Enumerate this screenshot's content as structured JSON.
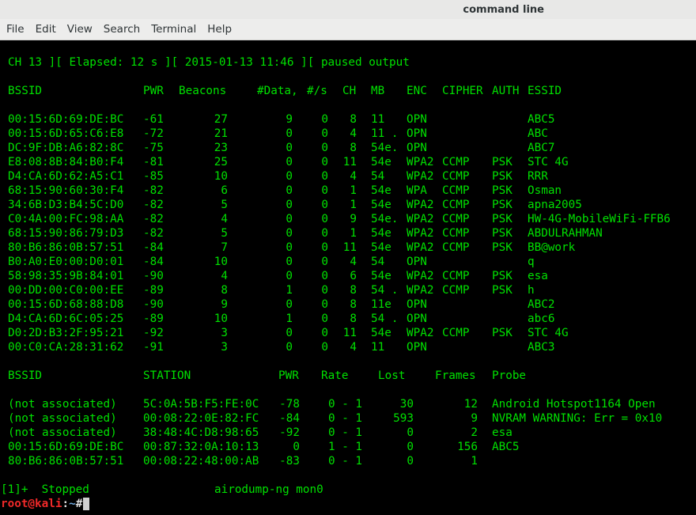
{
  "window": {
    "title": "command line"
  },
  "menu": [
    "File",
    "Edit",
    "View",
    "Search",
    "Terminal",
    "Help"
  ],
  "status_line": "CH 13 ][ Elapsed: 12 s ][ 2015-01-13 11:46 ][ paused output",
  "ap_headers": {
    "bssid": "BSSID",
    "pwr": "PWR",
    "beacons": "Beacons",
    "data": "#Data,",
    "rate": "#/s",
    "ch": "CH",
    "mb": "MB",
    "enc": "ENC",
    "cipher": "CIPHER",
    "auth": "AUTH",
    "essid": "ESSID"
  },
  "ap_rows": [
    {
      "bssid": "00:15:6D:69:DE:BC",
      "pwr": "-61",
      "beacons": "27",
      "data": "9",
      "rate": "0",
      "ch": "8",
      "mb": "11",
      "enc": "OPN",
      "cipher": "",
      "auth": "",
      "essid": "ABC5"
    },
    {
      "bssid": "00:15:6D:65:C6:E8",
      "pwr": "-72",
      "beacons": "21",
      "data": "0",
      "rate": "0",
      "ch": "4",
      "mb": "11 .",
      "enc": "OPN",
      "cipher": "",
      "auth": "",
      "essid": "ABC"
    },
    {
      "bssid": "DC:9F:DB:A6:82:8C",
      "pwr": "-75",
      "beacons": "23",
      "data": "0",
      "rate": "0",
      "ch": "8",
      "mb": "54e.",
      "enc": "OPN",
      "cipher": "",
      "auth": "",
      "essid": "ABC7"
    },
    {
      "bssid": "E8:08:8B:84:B0:F4",
      "pwr": "-81",
      "beacons": "25",
      "data": "0",
      "rate": "0",
      "ch": "11",
      "mb": "54e",
      "enc": "WPA2",
      "cipher": "CCMP",
      "auth": "PSK",
      "essid": "STC 4G"
    },
    {
      "bssid": "D4:CA:6D:62:A5:C1",
      "pwr": "-85",
      "beacons": "10",
      "data": "0",
      "rate": "0",
      "ch": "4",
      "mb": "54",
      "enc": "WPA2",
      "cipher": "CCMP",
      "auth": "PSK",
      "essid": "RRR"
    },
    {
      "bssid": "68:15:90:60:30:F4",
      "pwr": "-82",
      "beacons": "6",
      "data": "0",
      "rate": "0",
      "ch": "1",
      "mb": "54e",
      "enc": "WPA",
      "cipher": "CCMP",
      "auth": "PSK",
      "essid": "Osman"
    },
    {
      "bssid": "34:6B:D3:B4:5C:D0",
      "pwr": "-82",
      "beacons": "5",
      "data": "0",
      "rate": "0",
      "ch": "1",
      "mb": "54e",
      "enc": "WPA2",
      "cipher": "CCMP",
      "auth": "PSK",
      "essid": "apna2005"
    },
    {
      "bssid": "C0:4A:00:FC:98:AA",
      "pwr": "-82",
      "beacons": "4",
      "data": "0",
      "rate": "0",
      "ch": "9",
      "mb": "54e.",
      "enc": "WPA2",
      "cipher": "CCMP",
      "auth": "PSK",
      "essid": "HW-4G-MobileWiFi-FFB6"
    },
    {
      "bssid": "68:15:90:86:79:D3",
      "pwr": "-82",
      "beacons": "5",
      "data": "0",
      "rate": "0",
      "ch": "1",
      "mb": "54e",
      "enc": "WPA2",
      "cipher": "CCMP",
      "auth": "PSK",
      "essid": "ABDULRAHMAN"
    },
    {
      "bssid": "80:B6:86:0B:57:51",
      "pwr": "-84",
      "beacons": "7",
      "data": "0",
      "rate": "0",
      "ch": "11",
      "mb": "54e",
      "enc": "WPA2",
      "cipher": "CCMP",
      "auth": "PSK",
      "essid": "BB@work"
    },
    {
      "bssid": "B0:A0:E0:00:D0:01",
      "pwr": "-84",
      "beacons": "10",
      "data": "0",
      "rate": "0",
      "ch": "4",
      "mb": "54",
      "enc": "OPN",
      "cipher": "",
      "auth": "",
      "essid": "q"
    },
    {
      "bssid": "58:98:35:9B:84:01",
      "pwr": "-90",
      "beacons": "4",
      "data": "0",
      "rate": "0",
      "ch": "6",
      "mb": "54e",
      "enc": "WPA2",
      "cipher": "CCMP",
      "auth": "PSK",
      "essid": "esa"
    },
    {
      "bssid": "00:DD:00:C0:00:EE",
      "pwr": "-89",
      "beacons": "8",
      "data": "1",
      "rate": "0",
      "ch": "8",
      "mb": "54 .",
      "enc": "WPA2",
      "cipher": "CCMP",
      "auth": "PSK",
      "essid": "h"
    },
    {
      "bssid": "00:15:6D:68:88:D8",
      "pwr": "-90",
      "beacons": "9",
      "data": "0",
      "rate": "0",
      "ch": "8",
      "mb": "11e",
      "enc": "OPN",
      "cipher": "",
      "auth": "",
      "essid": "ABC2"
    },
    {
      "bssid": "D4:CA:6D:6C:05:25",
      "pwr": "-89",
      "beacons": "10",
      "data": "1",
      "rate": "0",
      "ch": "8",
      "mb": "54 .",
      "enc": "OPN",
      "cipher": "",
      "auth": "",
      "essid": "abc6"
    },
    {
      "bssid": "D0:2D:B3:2F:95:21",
      "pwr": "-92",
      "beacons": "3",
      "data": "0",
      "rate": "0",
      "ch": "11",
      "mb": "54e",
      "enc": "WPA2",
      "cipher": "CCMP",
      "auth": "PSK",
      "essid": "STC 4G"
    },
    {
      "bssid": "00:C0:CA:28:31:62",
      "pwr": "-91",
      "beacons": "3",
      "data": "0",
      "rate": "0",
      "ch": "4",
      "mb": "11",
      "enc": "OPN",
      "cipher": "",
      "auth": "",
      "essid": "ABC3"
    }
  ],
  "sta_headers": {
    "bssid": "BSSID",
    "station": "STATION",
    "pwr": "PWR",
    "rate": "Rate",
    "lost": "Lost",
    "frames": "Frames",
    "probe": "Probe"
  },
  "sta_rows": [
    {
      "bssid": "(not associated)",
      "station": "5C:0A:5B:F5:FE:0C",
      "pwr": "-78",
      "rate": "0 - 1",
      "lost": "30",
      "frames": "12",
      "probe": "Android Hotspot1164 Open"
    },
    {
      "bssid": "(not associated)",
      "station": "00:08:22:0E:82:FC",
      "pwr": "-84",
      "rate": "0 - 1",
      "lost": "593",
      "frames": "9",
      "probe": "NVRAM WARNING: Err = 0x10"
    },
    {
      "bssid": "(not associated)",
      "station": "38:48:4C:D8:98:65",
      "pwr": "-92",
      "rate": "0 - 1",
      "lost": "0",
      "frames": "2",
      "probe": "esa"
    },
    {
      "bssid": "00:15:6D:69:DE:BC",
      "station": "00:87:32:0A:10:13",
      "pwr": "0",
      "rate": "1 - 1",
      "lost": "0",
      "frames": "156",
      "probe": "ABC5"
    },
    {
      "bssid": "80:B6:86:0B:57:51",
      "station": "00:08:22:48:00:AB",
      "pwr": "-83",
      "rate": "0 - 1",
      "lost": "0",
      "frames": "1",
      "probe": ""
    }
  ],
  "job_line": {
    "job": "[1]+  Stopped",
    "command": "airodump-ng mon0"
  },
  "prompt": {
    "user": "root@kali",
    "sep": ":",
    "path": "~",
    "symbol": "#"
  }
}
